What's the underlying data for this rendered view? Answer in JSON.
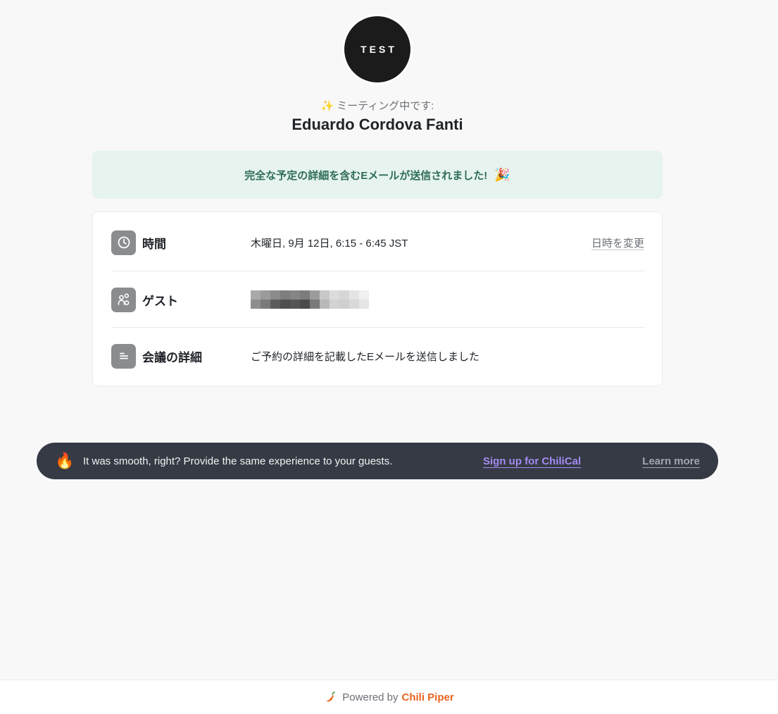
{
  "header": {
    "logo_text": "TEST",
    "subtitle_icon": "sparkles-icon",
    "subtitle": "ミーティング中です:",
    "host_name": "Eduardo Cordova Fanti"
  },
  "notice": {
    "text": "完全な予定の詳細を含むEメールが送信されました!",
    "icon": "party-popper-icon",
    "background_color": "#e6f3ef",
    "text_color": "#2f6d55"
  },
  "details": {
    "time": {
      "label": "時間",
      "value": "木曜日, 9月 12日, 6:15 - 6:45 JST",
      "action_label": "日時を変更",
      "icon": "clock-icon"
    },
    "guests": {
      "label": "ゲスト",
      "value_state": "pixelated",
      "icon": "users-icon"
    },
    "meeting_details": {
      "label": "会議の詳細",
      "value": "ご予約の詳細を記載したEメールを送信しました",
      "icon": "notes-icon"
    }
  },
  "promo": {
    "icon": "fire-icon",
    "text": "It was smooth, right? Provide the same experience to your guests.",
    "signup_label": "Sign up for ChiliCal",
    "learn_more_label": "Learn more",
    "background_color": "#353a44",
    "signup_color": "#a48bf2"
  },
  "footer": {
    "powered_by": "Powered by",
    "brand": "Chili Piper",
    "brand_color": "#e8641e",
    "icon": "chili-pepper-icon"
  }
}
